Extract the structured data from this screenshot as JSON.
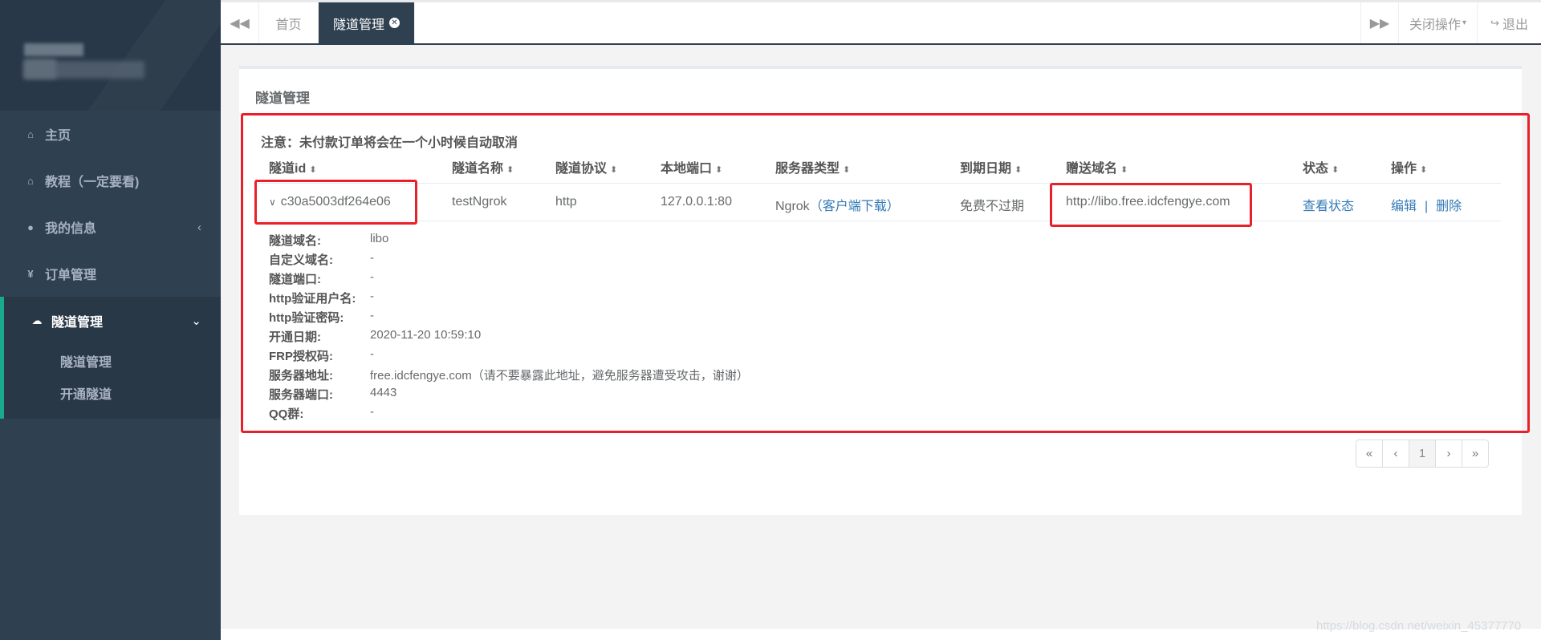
{
  "sidebar": {
    "items": [
      {
        "label": "主页",
        "icon": "home-icon"
      },
      {
        "label": "教程（一定要看)",
        "icon": "home-icon"
      },
      {
        "label": "我的信息",
        "icon": "user-icon",
        "arrow": "‹"
      },
      {
        "label": "订单管理",
        "icon": "yen-icon"
      },
      {
        "label": "隧道管理",
        "icon": "cloud-icon",
        "arrow": "⌄",
        "active": true
      }
    ],
    "subitems": [
      {
        "label": "隧道管理"
      },
      {
        "label": "开通隧道"
      }
    ]
  },
  "topbar": {
    "prev_icon": "double-left-icon",
    "next_icon": "double-right-icon",
    "tabs": [
      {
        "label": "首页"
      },
      {
        "label": "隧道管理",
        "active": true
      }
    ],
    "close_ops": "关闭操作",
    "logout": "退出"
  },
  "panel": {
    "title": "隧道管理",
    "notice": "注意：未付款订单将会在一个小时候自动取消",
    "columns": [
      "隧道id",
      "隧道名称",
      "隧道协议",
      "本地端口",
      "服务器类型",
      "到期日期",
      "赠送域名",
      "状态",
      "操作"
    ],
    "row": {
      "id": "c30a5003df264e06",
      "name": "testNgrok",
      "protocol": "http",
      "local_port": "127.0.0.1:80",
      "server_type": "Ngrok",
      "server_type_link_open": "（",
      "server_type_link": "客户端下载",
      "server_type_link_close": "）",
      "expiry": "免费不过期",
      "domain": "http://libo.free.idcfengye.com",
      "status_link": "查看状态",
      "edit_link": "编辑",
      "sep": "|",
      "delete_link": "删除"
    },
    "details": [
      {
        "key": "隧道域名:",
        "value": "libo"
      },
      {
        "key": "自定义域名:",
        "value": "-"
      },
      {
        "key": "隧道端口:",
        "value": "-"
      },
      {
        "key": "http验证用户名:",
        "value": "-"
      },
      {
        "key": "http验证密码:",
        "value": "-"
      },
      {
        "key": "开通日期:",
        "value": "2020-11-20 10:59:10"
      },
      {
        "key": "FRP授权码:",
        "value": "-"
      },
      {
        "key": "服务器地址:",
        "value": "free.idcfengye.com（请不要暴露此地址，避免服务器遭受攻击，谢谢）"
      },
      {
        "key": "服务器端口:",
        "value": "4443"
      },
      {
        "key": "QQ群:",
        "value": "-"
      }
    ]
  },
  "pagination": {
    "first": "«",
    "prev": "‹",
    "page": "1",
    "next": "›",
    "last": "»"
  },
  "watermark": "https://blog.csdn.net/weixin_45377770",
  "colors": {
    "sidebar_bg": "#2f4050",
    "accent": "#19aa8d",
    "link": "#337ab7",
    "highlight": "#e8202a"
  }
}
